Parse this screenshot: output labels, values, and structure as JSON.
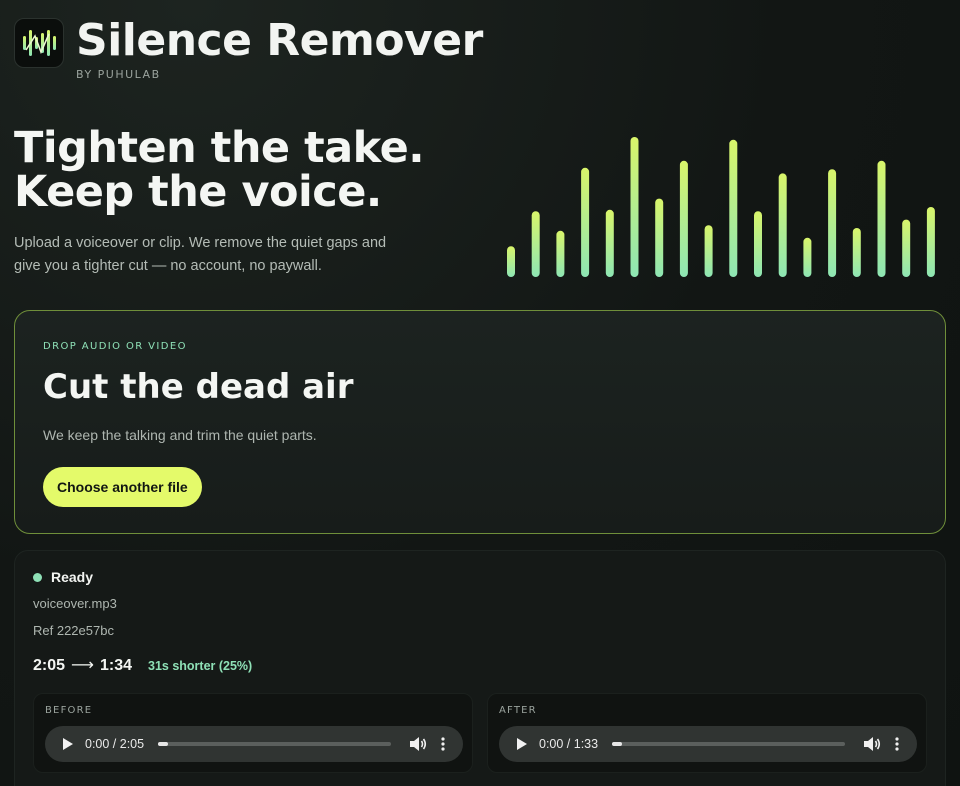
{
  "brand": {
    "logo_icon": "waveform-logo-icon",
    "title": "Silence Remover",
    "byline": "BY PUHULAB"
  },
  "hero": {
    "title_line1": "Tighten the take.",
    "title_line2": "Keep the voice.",
    "description": "Upload a voiceover or clip. We remove the quiet gaps and give you a tighter cut — no account, no paywall.",
    "waveform_levels": [
      0.22,
      0.47,
      0.33,
      0.78,
      0.48,
      1.0,
      0.56,
      0.83,
      0.37,
      0.98,
      0.47,
      0.74,
      0.28,
      0.77,
      0.35,
      0.83,
      0.41,
      0.5
    ],
    "colors": {
      "bar_top": "#d9f56a",
      "bar_bottom": "#8ee6b4"
    }
  },
  "drop": {
    "kicker": "DROP AUDIO OR VIDEO",
    "title": "Cut the dead air",
    "description": "We keep the talking and trim the quiet parts.",
    "button_label": "Choose another file",
    "colors": {
      "button": "#e4fa6a",
      "border": "#6f8f3a"
    }
  },
  "status": {
    "label": "Ready",
    "color": "#8ee0b6",
    "file_name": "voiceover.mp3",
    "ref": "Ref 222e57bc",
    "original_duration": "2:05",
    "arrow": "⟶",
    "new_duration": "1:34",
    "saved": "31s shorter (25%)"
  },
  "players": {
    "before": {
      "label": "BEFORE",
      "time": "0:00 / 2:05",
      "progress": 0.03
    },
    "after": {
      "label": "AFTER",
      "time": "0:00 / 1:33",
      "progress": 0.03
    },
    "icons": [
      "play-icon",
      "volume-icon",
      "more-options-icon"
    ]
  }
}
